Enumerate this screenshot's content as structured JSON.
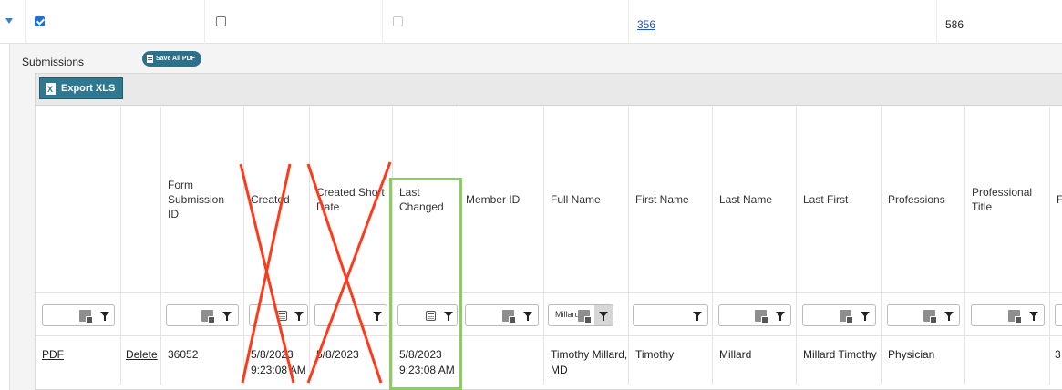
{
  "master_row": {
    "checkbox1_checked": true,
    "checkbox2_checked": false,
    "checkbox3_disabled": true,
    "link_value": "356",
    "count_value": "586"
  },
  "detail": {
    "submissions_label": "Submissions",
    "save_all_pdf_label": "Save All PDF",
    "export_xls_label": "Export XLS"
  },
  "columns": [
    {
      "key": "pdf",
      "header": ""
    },
    {
      "key": "delete",
      "header": ""
    },
    {
      "key": "form_submission_id",
      "header": "Form Submission ID"
    },
    {
      "key": "created",
      "header": "Created"
    },
    {
      "key": "created_short_date",
      "header": "Created Short Date"
    },
    {
      "key": "last_changed",
      "header": "Last Changed"
    },
    {
      "key": "member_id",
      "header": "Member ID"
    },
    {
      "key": "full_name",
      "header": "Full Name"
    },
    {
      "key": "first_name",
      "header": "First Name"
    },
    {
      "key": "last_name",
      "header": "Last Name"
    },
    {
      "key": "last_first",
      "header": "Last First"
    },
    {
      "key": "professions",
      "header": "Professions"
    },
    {
      "key": "professional_title",
      "header": "Professional Title"
    },
    {
      "key": "cut_off",
      "header": "F"
    }
  ],
  "filters": {
    "full_name_value": "Millard"
  },
  "row": {
    "pdf": "PDF",
    "delete": "Delete",
    "form_submission_id": "36052",
    "created": "5/8/2023\n9:23:08 AM",
    "created_short_date": "5/8/2023",
    "last_changed": "5/8/2023\n9:23:08 AM",
    "member_id": "",
    "full_name": "Timothy Millard,\nMD",
    "first_name": "Timothy",
    "last_name": "Millard",
    "last_first": "Millard Timothy",
    "professions": "Physician",
    "professional_title": "",
    "cut_off": "3"
  },
  "annotation_colors": {
    "cross": "#ff3a1a",
    "highlight_box": "#8acf5c"
  }
}
